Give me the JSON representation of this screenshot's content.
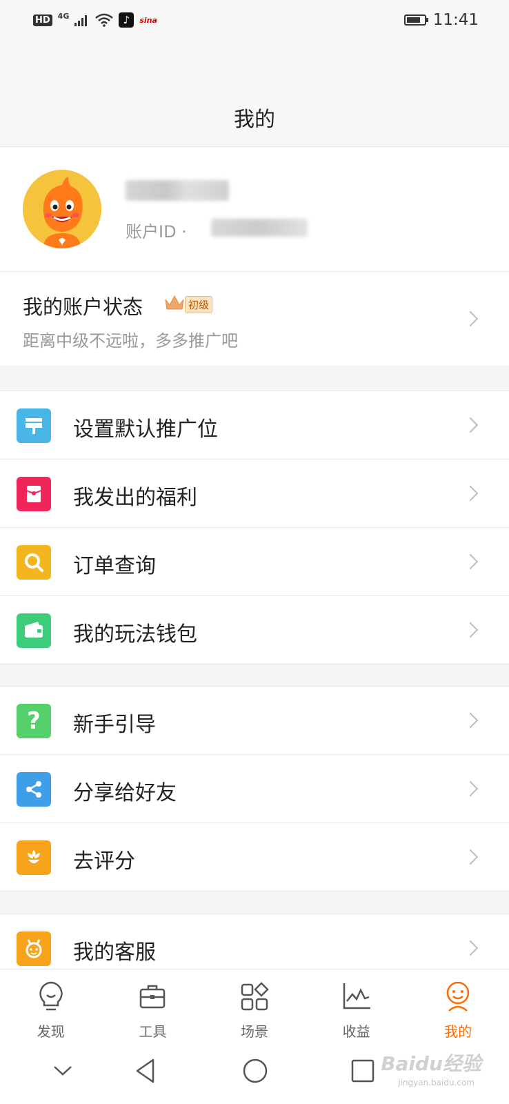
{
  "status_bar": {
    "network_badge": "HD",
    "signal_type": "4G",
    "time": "11:41",
    "battery_level": 0.8,
    "app_icons": [
      "tiktok-icon",
      "sina-icon"
    ],
    "sina_text": "sina"
  },
  "header": {
    "title": "我的"
  },
  "profile": {
    "id_label": "账户ID ·"
  },
  "account_status": {
    "title": "我的账户状态",
    "level_badge": "初级",
    "subtitle": "距离中级不远啦，多多推广吧"
  },
  "menu_groups": [
    [
      {
        "label": "设置默认推广位",
        "icon": "billboard-icon",
        "color": "#4ab6e8"
      },
      {
        "label": "我发出的福利",
        "icon": "red-envelope-icon",
        "color": "#f0265a"
      },
      {
        "label": "订单查询",
        "icon": "search-icon",
        "color": "#f4b61e"
      },
      {
        "label": "我的玩法钱包",
        "icon": "wallet-icon",
        "color": "#3ccc7a"
      }
    ],
    [
      {
        "label": "新手引导",
        "icon": "question-icon",
        "color": "#55d06a"
      },
      {
        "label": "分享给好友",
        "icon": "share-icon",
        "color": "#3f9ee8"
      },
      {
        "label": "去评分",
        "icon": "flower-icon",
        "color": "#f7a41c"
      }
    ],
    [
      {
        "label": "我的客服",
        "icon": "customer-service-icon",
        "color": "#f7a41c"
      }
    ]
  ],
  "tab_bar": [
    {
      "label": "发现",
      "icon": "lightbulb-icon",
      "active": false
    },
    {
      "label": "工具",
      "icon": "toolbox-icon",
      "active": false
    },
    {
      "label": "场景",
      "icon": "scenes-grid-icon",
      "active": false
    },
    {
      "label": "收益",
      "icon": "earnings-chart-icon",
      "active": false
    },
    {
      "label": "我的",
      "icon": "profile-face-icon",
      "active": true
    }
  ],
  "colors": {
    "accent": "#ff6a00"
  },
  "watermark": {
    "text": "Baidu经验",
    "url_text": "jingyan.baidu.com"
  }
}
